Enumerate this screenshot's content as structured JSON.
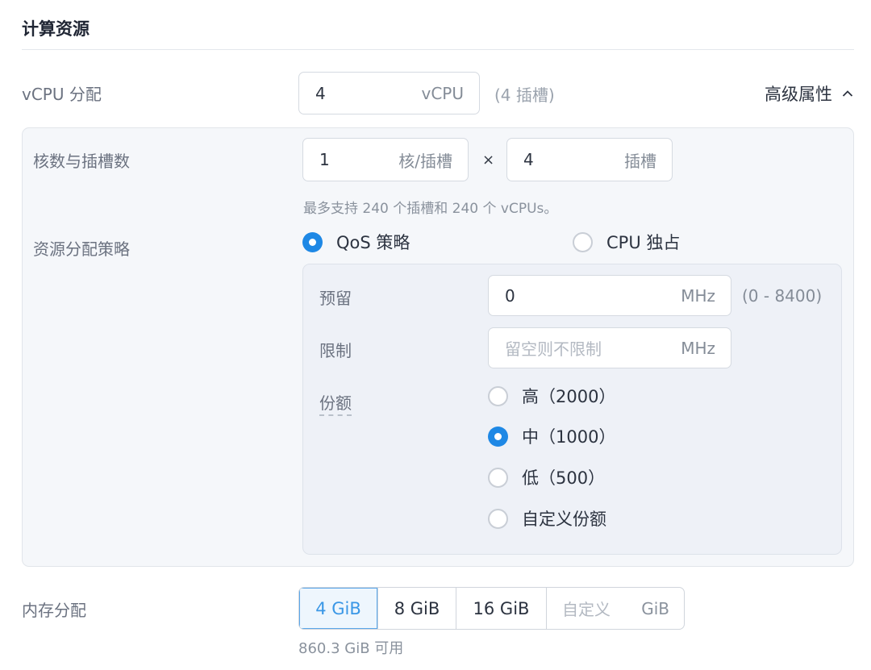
{
  "section": {
    "title": "计算资源"
  },
  "vcpu": {
    "label": "vCPU 分配",
    "value": "4",
    "unit": "vCPU",
    "sockets_note": "(4 插槽)"
  },
  "advanced": {
    "label": "高级属性",
    "expanded": true,
    "icon": "chevron-up-icon"
  },
  "cores": {
    "label": "核数与插槽数",
    "cores_value": "1",
    "cores_unit": "核/插槽",
    "times": "×",
    "sockets_value": "4",
    "sockets_unit": "插槽",
    "hint": "最多支持 240 个插槽和 240 个 vCPUs。"
  },
  "policy": {
    "label": "资源分配策略",
    "options": [
      {
        "label": "QoS 策略",
        "selected": true
      },
      {
        "label": "CPU 独占",
        "selected": false
      }
    ]
  },
  "qos": {
    "reservation": {
      "label": "预留",
      "value": "0",
      "unit": "MHz",
      "range": "(0 - 8400)"
    },
    "limit": {
      "label": "限制",
      "placeholder": "留空则不限制",
      "unit": "MHz"
    },
    "shares": {
      "label": "份额",
      "options": [
        {
          "label": "高（2000）",
          "selected": false
        },
        {
          "label": "中（1000）",
          "selected": true
        },
        {
          "label": "低（500）",
          "selected": false
        },
        {
          "label": "自定义份额",
          "selected": false
        }
      ]
    }
  },
  "memory": {
    "label": "内存分配",
    "options": [
      {
        "label": "4 GiB",
        "selected": true
      },
      {
        "label": "8 GiB",
        "selected": false
      },
      {
        "label": "16 GiB",
        "selected": false
      }
    ],
    "custom_placeholder": "自定义",
    "custom_unit": "GiB",
    "available": "860.3 GiB 可用"
  },
  "colors": {
    "accent": "#1e88e5",
    "panel_bg": "#f5f7fa",
    "subpanel_bg": "#eef1f7"
  }
}
